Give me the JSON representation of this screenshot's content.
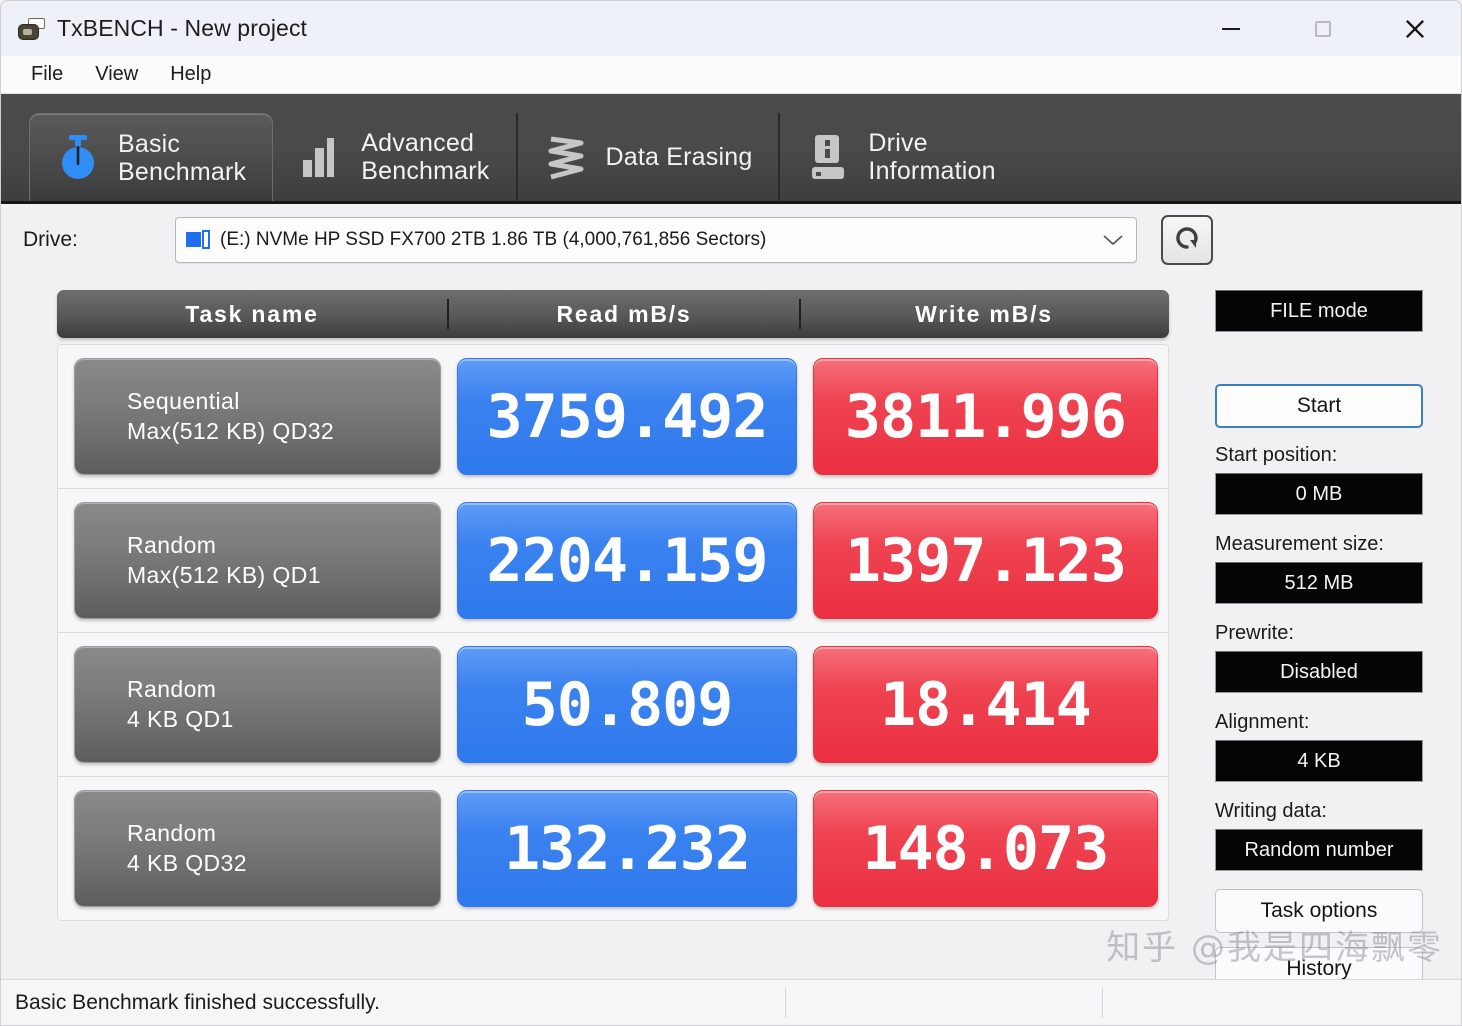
{
  "window": {
    "title": "TxBENCH - New project",
    "icon": "app-icon",
    "controls": {
      "minimize": "minimize-icon",
      "maximize": "maximize-icon",
      "close": "close-icon"
    }
  },
  "menu": {
    "items": [
      "File",
      "View",
      "Help"
    ]
  },
  "tabs": [
    {
      "label": "Basic\nBenchmark",
      "icon": "stopwatch-icon",
      "active": true
    },
    {
      "label": "Advanced\nBenchmark",
      "icon": "bar-chart-icon",
      "active": false
    },
    {
      "label": "Data Erasing",
      "icon": "zigzag-icon",
      "active": false
    },
    {
      "label": "Drive\nInformation",
      "icon": "hard-drive-icon",
      "active": false
    }
  ],
  "drive": {
    "label": "Drive:",
    "value": "(E:) NVMe HP SSD FX700 2TB  1.86 TB (4,000,761,856 Sectors)",
    "caret": "chevron-down-icon",
    "refresh": "refresh-icon"
  },
  "table": {
    "headers": {
      "name": "Task name",
      "read": "Read mB/s",
      "write": "Write mB/s"
    },
    "rows": [
      {
        "line1": "Sequential",
        "line2": "Max(512 KB) QD32",
        "read": "3759.492",
        "write": "3811.996"
      },
      {
        "line1": "Random",
        "line2": "Max(512 KB) QD1",
        "read": "2204.159",
        "write": "1397.123"
      },
      {
        "line1": "Random",
        "line2": "4 KB QD1",
        "read": "50.809",
        "write": "18.414"
      },
      {
        "line1": "Random",
        "line2": "4 KB QD32",
        "read": "132.232",
        "write": "148.073"
      }
    ]
  },
  "sidebar": {
    "mode": "FILE mode",
    "start": "Start",
    "start_position_label": "Start position:",
    "start_position_value": "0 MB",
    "measurement_size_label": "Measurement size:",
    "measurement_size_value": "512 MB",
    "prewrite_label": "Prewrite:",
    "prewrite_value": "Disabled",
    "alignment_label": "Alignment:",
    "alignment_value": "4 KB",
    "writing_data_label": "Writing data:",
    "writing_data_value": "Random number",
    "task_options": "Task options",
    "history": "History"
  },
  "status": {
    "message": "Basic Benchmark finished successfully."
  },
  "watermark": {
    "text": "知乎 @我是四海飘零"
  },
  "colors": {
    "read_bar": "#3b82f0",
    "write_bar": "#ef4452",
    "tabstrip": "#4a4a4a",
    "accent": "#1d6ff0"
  }
}
